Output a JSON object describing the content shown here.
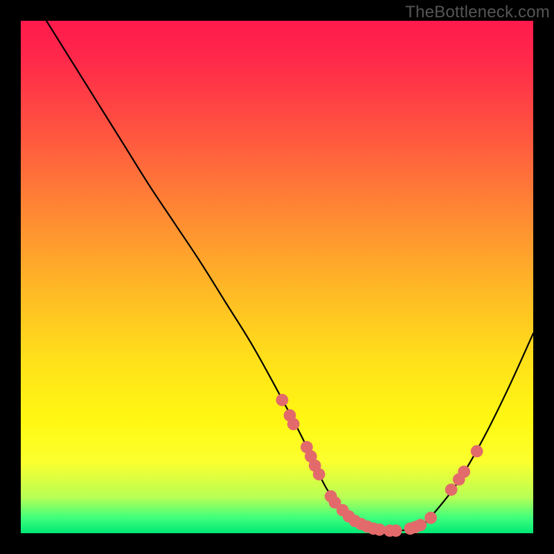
{
  "watermark": "TheBottleneck.com",
  "chart_data": {
    "type": "line",
    "title": "",
    "xlabel": "",
    "ylabel": "",
    "xlim": [
      0,
      100
    ],
    "ylim": [
      0,
      100
    ],
    "curve": {
      "x": [
        5,
        10,
        15,
        20,
        25,
        30,
        35,
        40,
        45,
        50,
        55,
        58,
        60,
        63,
        66,
        70,
        74,
        78,
        80,
        85,
        90,
        95,
        100
      ],
      "y": [
        100,
        92,
        84,
        76,
        68,
        60.5,
        53,
        45,
        37,
        28,
        18.5,
        12,
        8.2,
        4.5,
        2.2,
        0.8,
        0.5,
        1.5,
        3.2,
        9.5,
        18,
        28,
        39
      ]
    },
    "markers": [
      {
        "x": 51.0,
        "y": 26.0
      },
      {
        "x": 52.5,
        "y": 23.0
      },
      {
        "x": 53.2,
        "y": 21.3
      },
      {
        "x": 55.8,
        "y": 16.8
      },
      {
        "x": 56.6,
        "y": 15.0
      },
      {
        "x": 57.4,
        "y": 13.2
      },
      {
        "x": 58.2,
        "y": 11.5
      },
      {
        "x": 60.5,
        "y": 7.2
      },
      {
        "x": 61.3,
        "y": 6.0
      },
      {
        "x": 62.8,
        "y": 4.5
      },
      {
        "x": 64.0,
        "y": 3.3
      },
      {
        "x": 65.2,
        "y": 2.4
      },
      {
        "x": 66.4,
        "y": 1.8
      },
      {
        "x": 67.6,
        "y": 1.3
      },
      {
        "x": 68.8,
        "y": 0.9
      },
      {
        "x": 70.0,
        "y": 0.7
      },
      {
        "x": 72.0,
        "y": 0.5
      },
      {
        "x": 73.2,
        "y": 0.5
      },
      {
        "x": 76.0,
        "y": 0.9
      },
      {
        "x": 77.0,
        "y": 1.2
      },
      {
        "x": 78.0,
        "y": 1.6
      },
      {
        "x": 80.0,
        "y": 3.0
      },
      {
        "x": 84.0,
        "y": 8.5
      },
      {
        "x": 85.5,
        "y": 10.5
      },
      {
        "x": 86.5,
        "y": 12.0
      },
      {
        "x": 89.0,
        "y": 16.0
      }
    ],
    "marker_color": "#e36a6a",
    "marker_radius": 1.2
  }
}
